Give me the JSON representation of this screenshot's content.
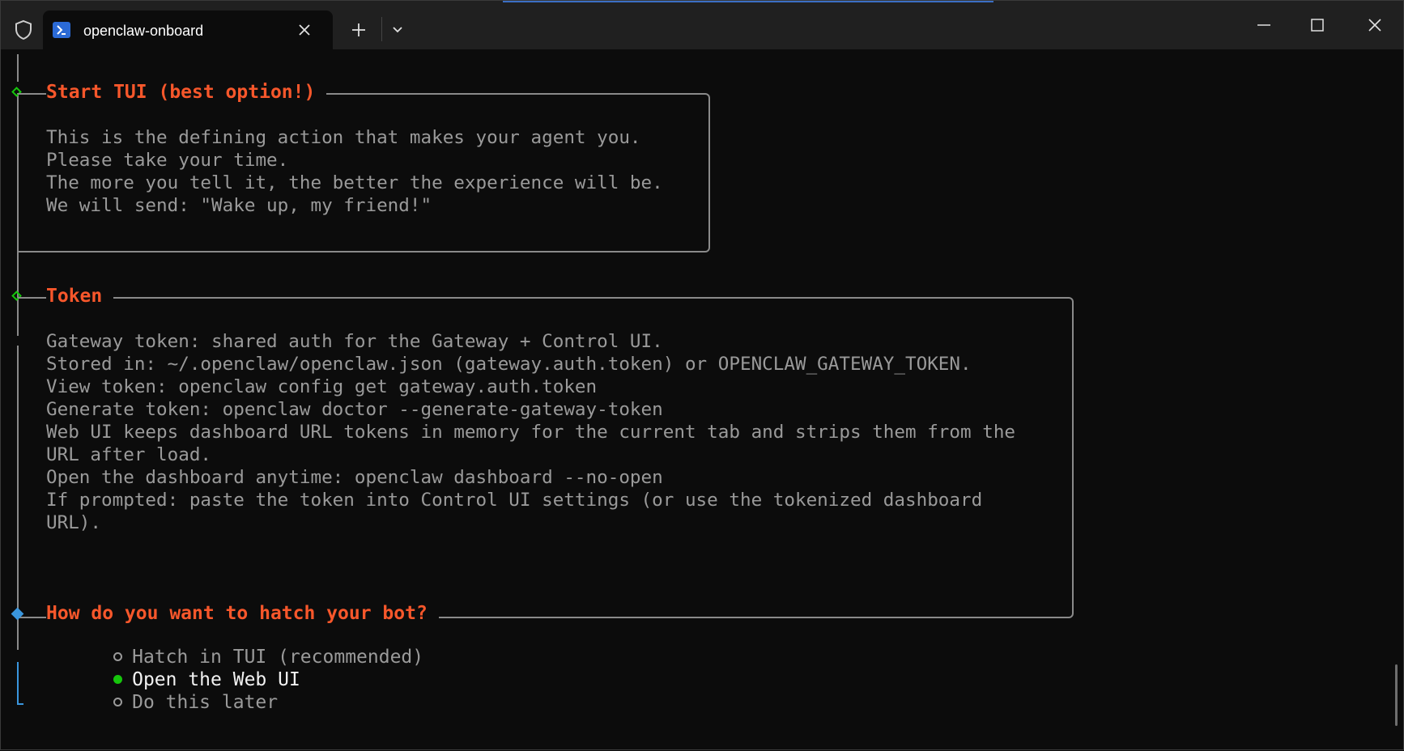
{
  "window": {
    "tab_title": "openclaw-onboard",
    "accent_color": "#3b6fc4"
  },
  "icons": {
    "shield": "shield-icon",
    "terminal": "powershell-icon",
    "close": "close-icon",
    "new_tab": "plus-icon",
    "dropdown": "chevron-down-icon",
    "minimize": "minimize-icon",
    "maximize": "maximize-icon",
    "window_close": "close-icon"
  },
  "colors": {
    "heading": "#f7572b",
    "text": "#9a9a9a",
    "selected_text": "#f2f2f2",
    "marker_green": "#16c60c",
    "marker_blue": "#3a96dd"
  },
  "sections": {
    "start_tui": {
      "title": "Start TUI (best option!)",
      "lines": [
        "This is the defining action that makes your agent you.",
        "Please take your time.",
        "The more you tell it, the better the experience will be.",
        "We will send: \"Wake up, my friend!\""
      ]
    },
    "token": {
      "title": "Token",
      "lines": [
        "Gateway token: shared auth for the Gateway + Control UI.",
        "Stored in: ~/.openclaw/openclaw.json (gateway.auth.token) or OPENCLAW_GATEWAY_TOKEN.",
        "View token: openclaw config get gateway.auth.token",
        "Generate token: openclaw doctor --generate-gateway-token",
        "Web UI keeps dashboard URL tokens in memory for the current tab and strips them from the",
        "URL after load.",
        "Open the dashboard anytime: openclaw dashboard --no-open",
        "If prompted: paste the token into Control UI settings (or use the tokenized dashboard",
        "URL)."
      ]
    }
  },
  "prompt": {
    "question": "How do you want to hatch your bot?",
    "options": [
      {
        "label": "Hatch in TUI (recommended)",
        "selected": false
      },
      {
        "label": "Open the Web UI",
        "selected": true
      },
      {
        "label": "Do this later",
        "selected": false
      }
    ]
  }
}
